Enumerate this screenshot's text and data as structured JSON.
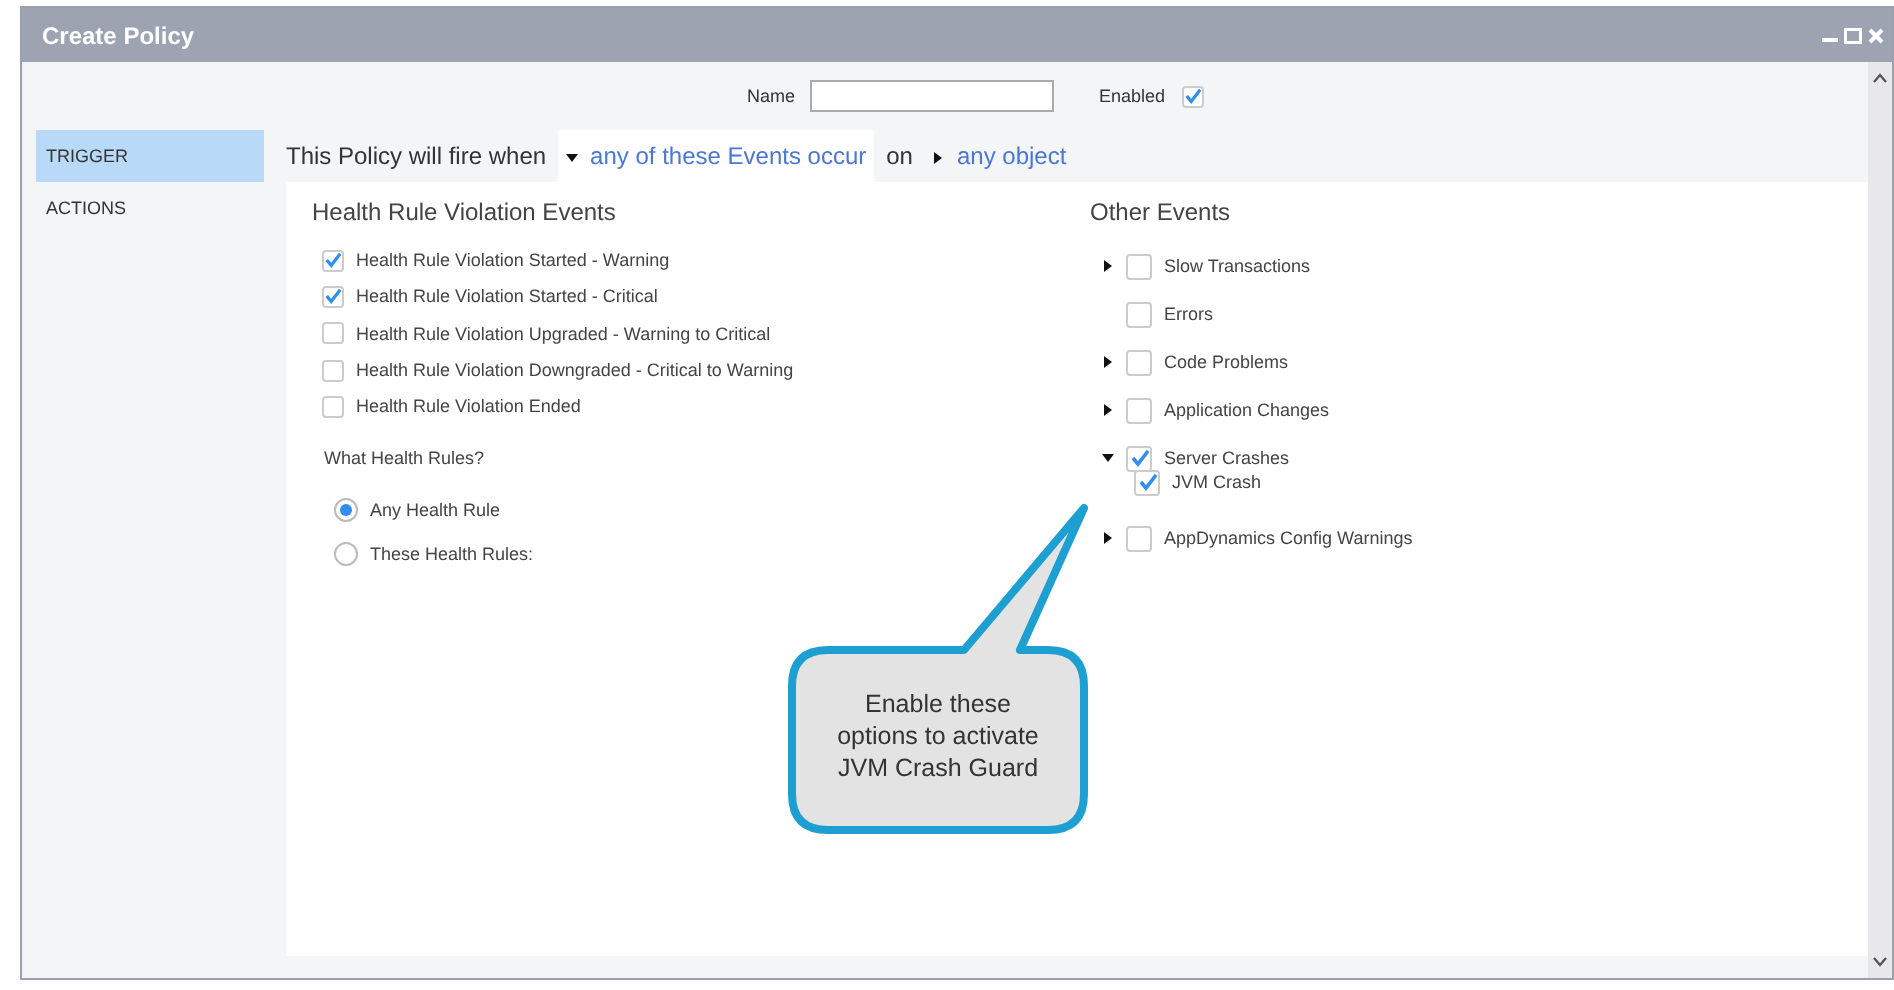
{
  "window": {
    "title": "Create Policy"
  },
  "form": {
    "name_label": "Name",
    "enabled_label": "Enabled",
    "enabled": true
  },
  "sidebar": {
    "items": [
      {
        "label": "TRIGGER",
        "selected": true
      },
      {
        "label": "ACTIONS",
        "selected": false
      }
    ]
  },
  "trigger": {
    "lead": "This Policy will fire when",
    "events_link": "any of these Events occur",
    "joiner": "on",
    "object_link": "any object"
  },
  "health_rule_events": {
    "title": "Health Rule Violation Events",
    "items": [
      {
        "label": "Health Rule Violation Started - Warning",
        "checked": true
      },
      {
        "label": "Health Rule Violation Started - Critical",
        "checked": true
      },
      {
        "label": "Health Rule Violation Upgraded - Warning to Critical",
        "checked": false
      },
      {
        "label": "Health Rule Violation Downgraded - Critical to Warning",
        "checked": false
      },
      {
        "label": "Health Rule Violation Ended",
        "checked": false
      }
    ],
    "question": "What Health Rules?",
    "options": [
      {
        "label": "Any Health Rule",
        "selected": true
      },
      {
        "label": "These Health Rules:",
        "selected": false
      }
    ]
  },
  "other_events": {
    "title": "Other Events",
    "items": [
      {
        "label": "Slow Transactions",
        "checked": false,
        "expanded": false
      },
      {
        "label": "Errors",
        "checked": false
      },
      {
        "label": "Code Problems",
        "checked": false,
        "expanded": false
      },
      {
        "label": "Application Changes",
        "checked": false,
        "expanded": false
      },
      {
        "label": "Server Crashes",
        "checked": true,
        "expanded": true,
        "children": [
          {
            "label": "JVM Crash",
            "checked": true
          }
        ]
      },
      {
        "label": "AppDynamics Config Warnings",
        "checked": false,
        "expanded": false
      }
    ]
  },
  "callout": {
    "text": "Enable these options to activate JVM Crash Guard"
  }
}
